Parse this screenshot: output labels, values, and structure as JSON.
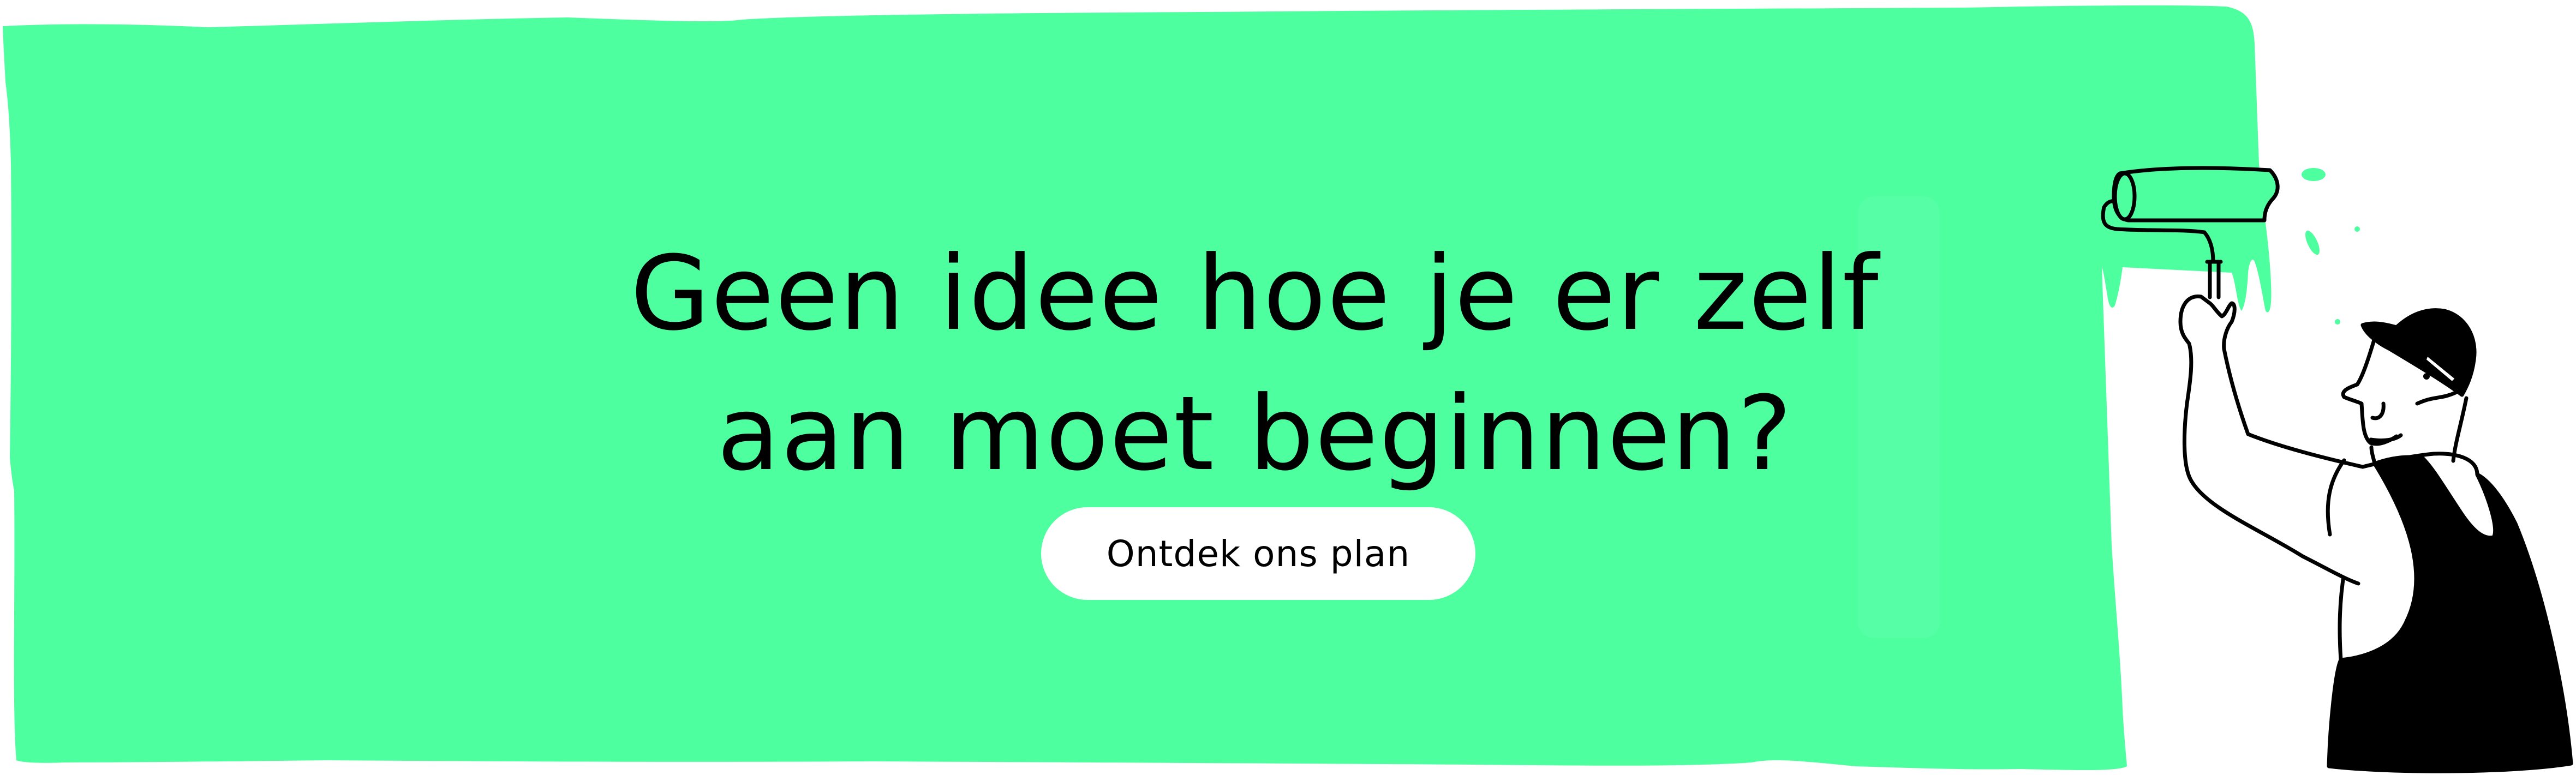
{
  "banner": {
    "headline_line1": "Geen idee hoe je er zelf",
    "headline_line2": "aan moet beginnen?",
    "cta_label": "Ontdek ons plan"
  },
  "illustration": {
    "subject": "painter-with-paint-roller",
    "icon": "painter-illustration-icon"
  },
  "colors": {
    "paint_green": "#4DFF9E",
    "text": "#000000",
    "button_bg": "#FFFFFF",
    "outline": "#000000"
  }
}
